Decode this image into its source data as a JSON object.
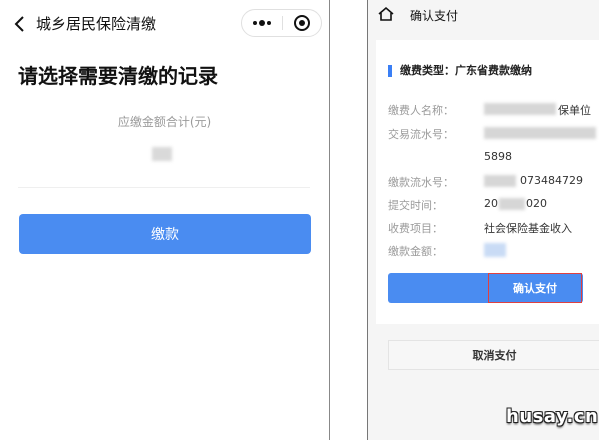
{
  "left": {
    "nav_title": "城乡居民保险清缴",
    "heading": "请选择需要清缴的记录",
    "amount_label": "应缴金额合计(元)",
    "pay_button": "缴款"
  },
  "right": {
    "nav_title": "确认支付",
    "payment_type": "缴费类型：广东省费款缴纳",
    "rows": [
      {
        "label": "缴费人名称：",
        "value": "保单位"
      },
      {
        "label": "交易流水号：",
        "value": ""
      },
      {
        "label": "",
        "value": "5898"
      },
      {
        "label": "缴款流水号：",
        "value": "073484729"
      },
      {
        "label": "提交时间：",
        "value_prefix": "20",
        "value": "020"
      },
      {
        "label": "收费项目：",
        "value": "社会保险基金收入"
      },
      {
        "label": "缴款金额：",
        "value": ""
      }
    ],
    "confirm_button": "确认支付",
    "cancel_button": "取消支付"
  },
  "watermark": "husay.cn",
  "colors": {
    "accent": "#4a8cf1",
    "highlight_border": "#e04040"
  }
}
